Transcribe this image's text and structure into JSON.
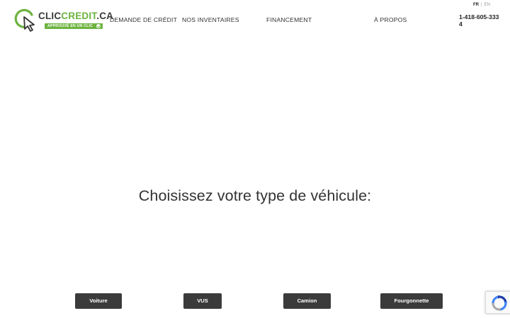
{
  "header": {
    "logo": {
      "word_dark": "CLIC",
      "word_green": "CREDIT",
      "word_suffix": ".CA",
      "tagline": "APPROUVÉ EN UN CLIC"
    },
    "nav": [
      {
        "label": "DEMANDE DE CRÉDIT"
      },
      {
        "label": "NOS INVENTAIRES"
      },
      {
        "label": "FINANCEMENT"
      },
      {
        "label": "À PROPOS"
      }
    ],
    "languages": {
      "active": "FR",
      "separator": "|",
      "other": "EN"
    },
    "phone": "1-418-605-3334"
  },
  "main": {
    "heading": "Choisissez votre type de véhicule:",
    "vehicle_types": [
      {
        "label": "Voiture"
      },
      {
        "label": "VUS"
      },
      {
        "label": "Camion"
      },
      {
        "label": "Fourgonnette"
      }
    ]
  },
  "theme": {
    "brand_green": "#6cb33f",
    "button_bg": "#3b3b3b",
    "text": "#333333"
  },
  "icons": {
    "logo_mark": "magnifier-cursor-icon",
    "recaptcha": "recaptcha-icon"
  }
}
